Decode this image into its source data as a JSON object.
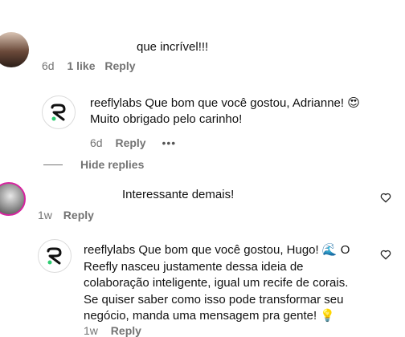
{
  "comments": [
    {
      "text": "que incrível!!!",
      "time": "6d",
      "likes": "1 like",
      "reply_label": "Reply"
    },
    {
      "user": "reeflylabs",
      "text_line1": "Que bom que você gostou, Adrianne! 😍",
      "text_line2": "Muito obrigado pelo carinho!",
      "time": "6d",
      "reply_label": "Reply",
      "more_label": "•••"
    },
    {
      "hide_replies_label": "Hide replies"
    },
    {
      "text": "Interessante demais!",
      "time": "1w",
      "reply_label": "Reply"
    },
    {
      "user": "reeflylabs",
      "line1": "Que bom que você gostou, Hugo! 🌊 O",
      "line2": "Reefly nasceu justamente dessa ideia de",
      "line3": "colaboração inteligente, igual um recife de corais.",
      "line4": "Se quiser saber como isso pode transformar seu",
      "line5": "negócio, manda uma mensagem pra gente! 💡",
      "time": "1w",
      "reply_label": "Reply"
    }
  ],
  "colors": {
    "accent_green": "#2ecc71",
    "meta_gray": "#737373"
  }
}
